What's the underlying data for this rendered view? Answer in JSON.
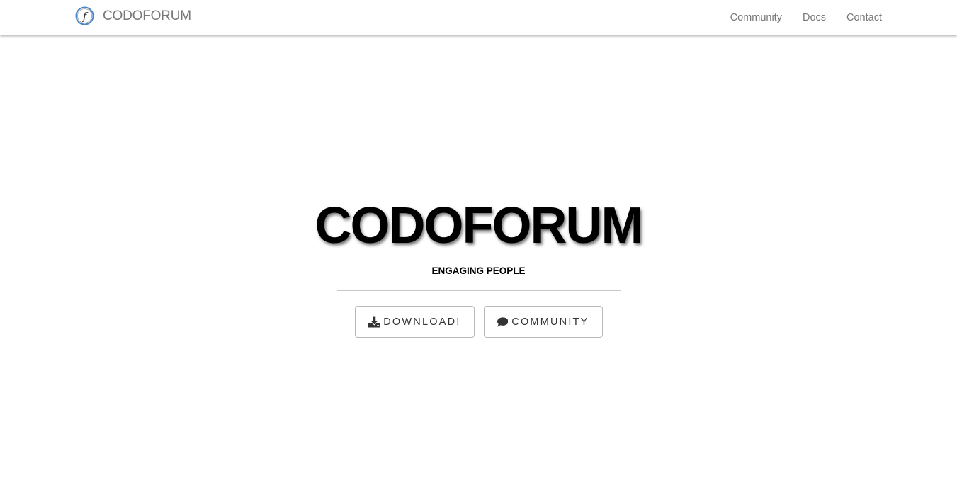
{
  "navbar": {
    "brand_text": "CODOFORUM",
    "logo_icon": "forum-f-logo-icon",
    "links": [
      {
        "label": "Community"
      },
      {
        "label": "Docs"
      },
      {
        "label": "Contact"
      }
    ]
  },
  "hero": {
    "title": "CODOFORUM",
    "subtitle": "ENGAGING PEOPLE",
    "buttons": {
      "download_label": "DOWNLOAD!",
      "download_icon": "download-icon",
      "community_label": "COMMUNITY",
      "community_icon": "comment-icon"
    }
  },
  "colors": {
    "nav_text": "#777777",
    "logo_ring": "#4a86c8",
    "title": "#000000",
    "button_border": "#b8b8b8",
    "button_text": "#333333"
  }
}
